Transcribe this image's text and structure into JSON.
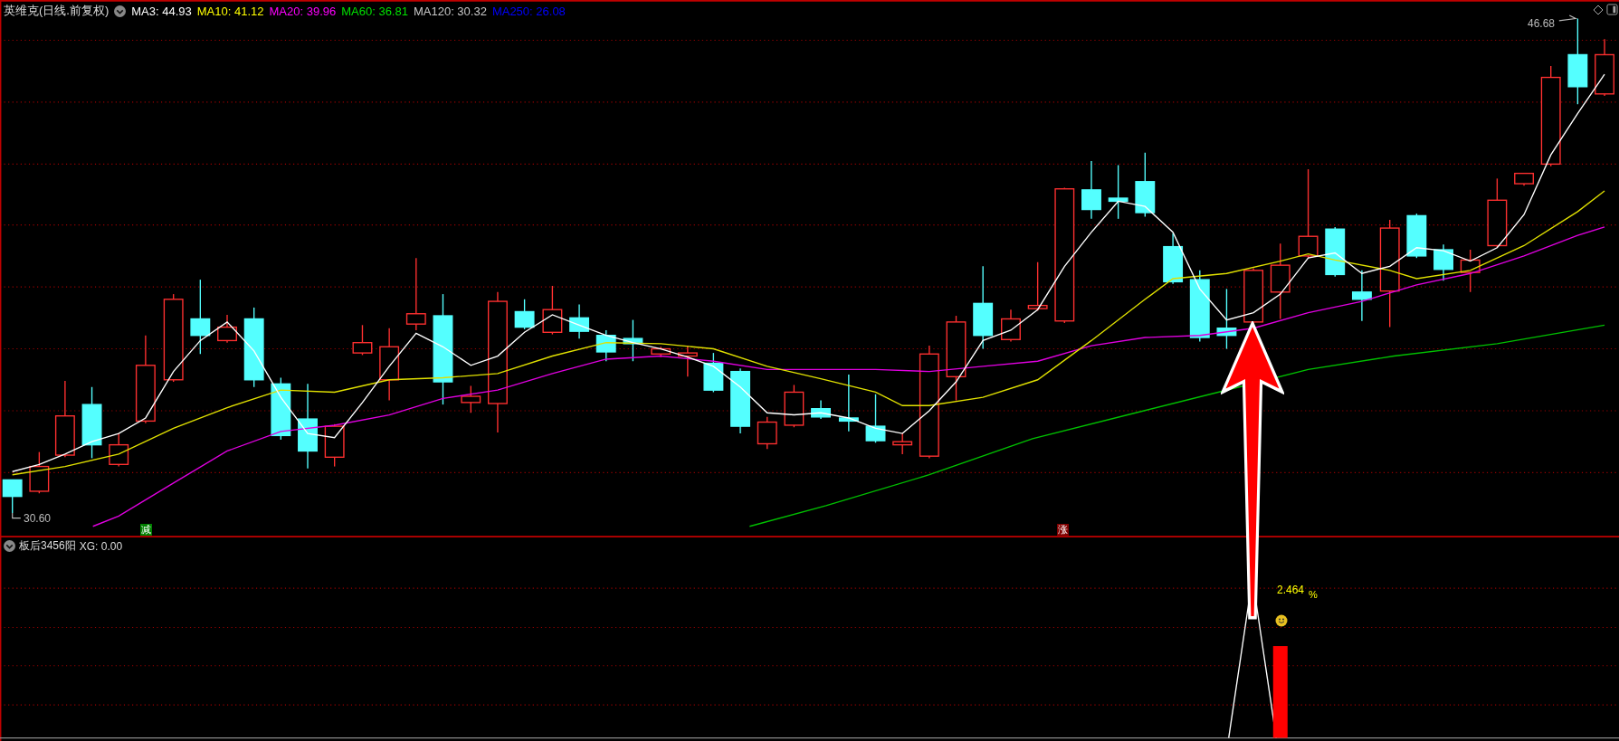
{
  "main_panel": {
    "title": "英维克(日线.前复权)",
    "indicators": [
      {
        "label": "MA3: 44.93",
        "color": "#ffffff"
      },
      {
        "label": "MA10: 41.12",
        "color": "#ffff00"
      },
      {
        "label": "MA20: 39.96",
        "color": "#ff00ff"
      },
      {
        "label": "MA60: 36.81",
        "color": "#00e000"
      },
      {
        "label": "MA120: 30.32",
        "color": "#c8c8c8"
      },
      {
        "label": "MA250: 26.08",
        "color": "#0000ff"
      }
    ],
    "low_label": "30.60",
    "high_label": "46.68",
    "markers": [
      {
        "text": "减",
        "color": "#008000"
      },
      {
        "text": "涨",
        "color": "#800000"
      }
    ]
  },
  "sub_panel": {
    "title": "板后3456阳",
    "reading": "XG: 0.00",
    "signal_value": "2.464",
    "signal_unit": "%"
  }
}
